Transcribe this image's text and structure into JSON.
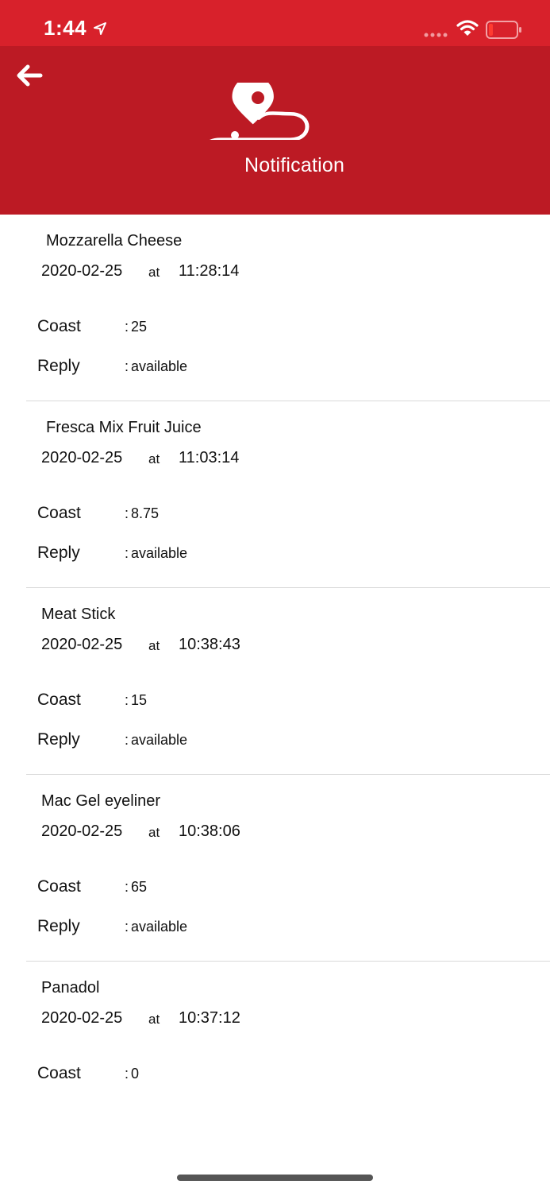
{
  "status_bar": {
    "time": "1:44",
    "icons": [
      "location-arrow-icon",
      "cellular-signal-icon",
      "wifi-icon",
      "battery-low-icon"
    ]
  },
  "header": {
    "logo_text": "Notification",
    "colors": {
      "status_red": "#d8212b",
      "header_red": "#bc1a24"
    }
  },
  "notifications": [
    {
      "title": "Mozzarella Cheese",
      "date": "2020-02-25",
      "at": "at",
      "time": "11:28:14",
      "coast_label": "Coast",
      "coast_value": "25",
      "reply_label": "Reply",
      "reply_value": "available"
    },
    {
      "title": "Fresca Mix Fruit Juice",
      "date": "2020-02-25",
      "at": "at",
      "time": "11:03:14",
      "coast_label": "Coast",
      "coast_value": "8.75",
      "reply_label": "Reply",
      "reply_value": "available"
    },
    {
      "title": "Meat Stick",
      "date": "2020-02-25",
      "at": "at",
      "time": "10:38:43",
      "coast_label": "Coast",
      "coast_value": "15",
      "reply_label": "Reply",
      "reply_value": "available"
    },
    {
      "title": "Mac Gel eyeliner",
      "date": "2020-02-25",
      "at": "at",
      "time": "10:38:06",
      "coast_label": "Coast",
      "coast_value": "65",
      "reply_label": "Reply",
      "reply_value": "available"
    },
    {
      "title": "Panadol",
      "date": "2020-02-25",
      "at": "at",
      "time": "10:37:12",
      "coast_label": "Coast",
      "coast_value": "0"
    }
  ]
}
